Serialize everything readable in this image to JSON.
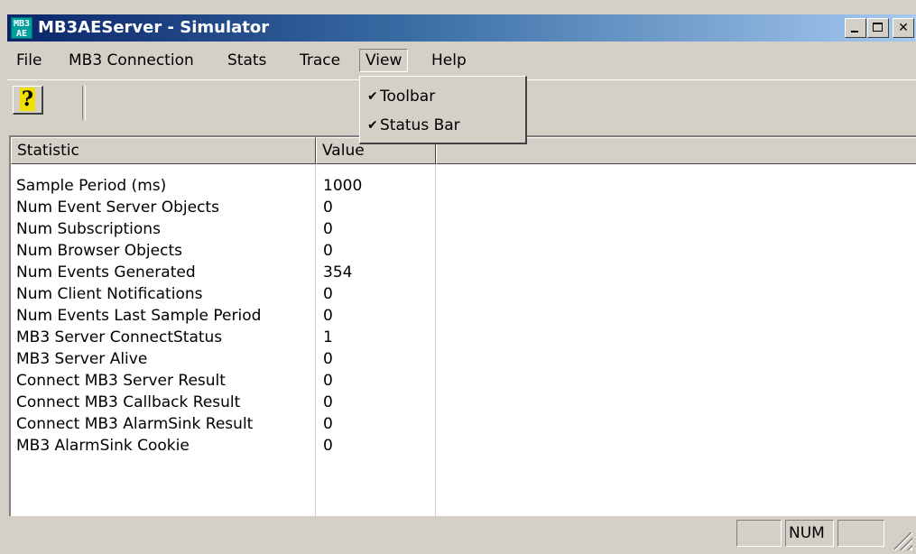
{
  "window": {
    "title": "MB3AEServer - Simulator",
    "app_icon_text": "MB3\nAE"
  },
  "menubar": {
    "items": [
      "File",
      "MB3 Connection",
      "Stats",
      "Trace",
      "View",
      "Help"
    ],
    "active": "View"
  },
  "view_menu": {
    "items": [
      {
        "label": "Toolbar",
        "checked": true
      },
      {
        "label": "Status Bar",
        "checked": true
      }
    ]
  },
  "toolbar": {
    "help_button_glyph": "?",
    "help_icon": "help-question-icon"
  },
  "list": {
    "columns": [
      "Statistic",
      "Value",
      ""
    ],
    "rows": [
      {
        "statistic": "Sample Period (ms)",
        "value": "1000"
      },
      {
        "statistic": "Num Event Server Objects",
        "value": "0"
      },
      {
        "statistic": "Num Subscriptions",
        "value": "0"
      },
      {
        "statistic": "Num Browser Objects",
        "value": "0"
      },
      {
        "statistic": "Num Events Generated",
        "value": "354"
      },
      {
        "statistic": "Num Client Notifications",
        "value": "0"
      },
      {
        "statistic": "Num Events Last Sample Period",
        "value": "0"
      },
      {
        "statistic": "MB3 Server ConnectStatus",
        "value": "1"
      },
      {
        "statistic": "MB3 Server Alive",
        "value": "0"
      },
      {
        "statistic": "Connect MB3 Server Result",
        "value": "0"
      },
      {
        "statistic": "Connect MB3 Callback Result",
        "value": "0"
      },
      {
        "statistic": "Connect MB3 AlarmSink Result",
        "value": "0"
      },
      {
        "statistic": "MB3 AlarmSink Cookie",
        "value": "0"
      }
    ]
  },
  "statusbar": {
    "message": "",
    "caps": "",
    "num": "NUM",
    "scrl": ""
  },
  "colors": {
    "title_start": "#0a246a",
    "title_end": "#a6caf0",
    "face": "#d4d0c8"
  }
}
